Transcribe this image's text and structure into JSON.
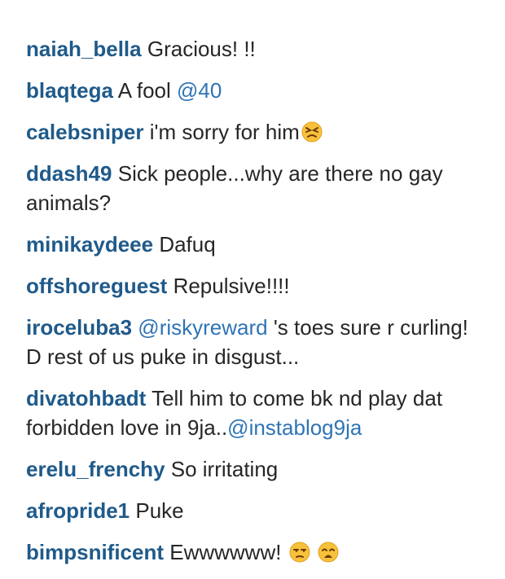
{
  "comments": [
    {
      "username": "naiah_bella",
      "parts": [
        " Gracious! !!"
      ]
    },
    {
      "username": "blaqtega",
      "parts": [
        " A fool "
      ],
      "mention": "@40"
    },
    {
      "username": "calebsniper",
      "parts": [
        " i'm sorry for him"
      ],
      "emoji": "persevering-face"
    },
    {
      "username": "ddash49",
      "parts": [
        " Sick people...why are there no gay animals?"
      ]
    },
    {
      "username": "minikaydeee",
      "parts": [
        " Dafuq"
      ]
    },
    {
      "username": "offshoreguest",
      "parts": [
        " Repulsive!!!!"
      ]
    },
    {
      "username": "iroceluba3",
      "pre": " ",
      "mention": "@riskyreward",
      "post": " 's toes sure r curling! D rest of us puke in disgust..."
    },
    {
      "username": "divatohbadt",
      "pre": " Tell him to come bk nd play dat forbidden love in 9ja..",
      "mention": "@instablog9ja"
    },
    {
      "username": "erelu_frenchy",
      "parts": [
        " So irritating"
      ]
    },
    {
      "username": "afropride1",
      "parts": [
        " Puke"
      ]
    },
    {
      "username": "bimpsnificent",
      "parts": [
        " Ewwwwww! "
      ],
      "emojis": [
        "unamused-face",
        "weary-face"
      ]
    }
  ]
}
